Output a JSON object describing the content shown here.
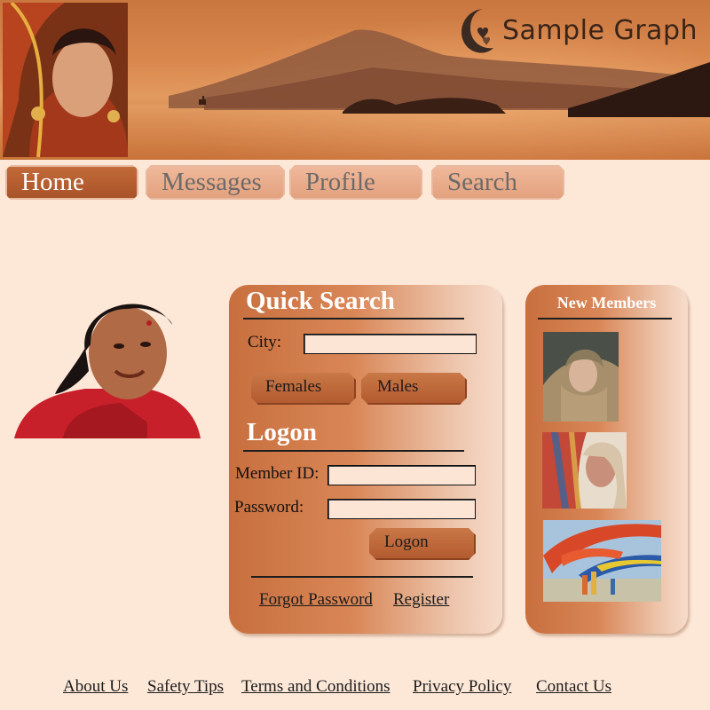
{
  "header": {
    "logo_text": "Sample Graph",
    "portrait_alt": "woman in red bridal attire"
  },
  "nav": {
    "tabs": [
      {
        "label": "Home",
        "active": true
      },
      {
        "label": "Messages",
        "active": false
      },
      {
        "label": "Profile",
        "active": false
      },
      {
        "label": "Search",
        "active": false
      }
    ]
  },
  "quick_search": {
    "title": "Quick Search",
    "city_label": "City:",
    "city_value": "",
    "females_label": "Females",
    "males_label": "Males"
  },
  "logon": {
    "title": "Logon",
    "member_id_label": "Member ID:",
    "member_id_value": "",
    "password_label": "Password:",
    "password_value": "",
    "submit_label": "Logon",
    "forgot_password_label": "Forgot Password",
    "register_label": "Register"
  },
  "new_members": {
    "title": "New Members"
  },
  "footer": {
    "links": [
      "About Us",
      "Safety Tips",
      "Terms and Conditions",
      "Privacy Policy",
      "Contact Us"
    ]
  },
  "colors": {
    "page_background": "#fde8d8",
    "accent": "#b2592f",
    "active_tab": "#a9532a"
  }
}
